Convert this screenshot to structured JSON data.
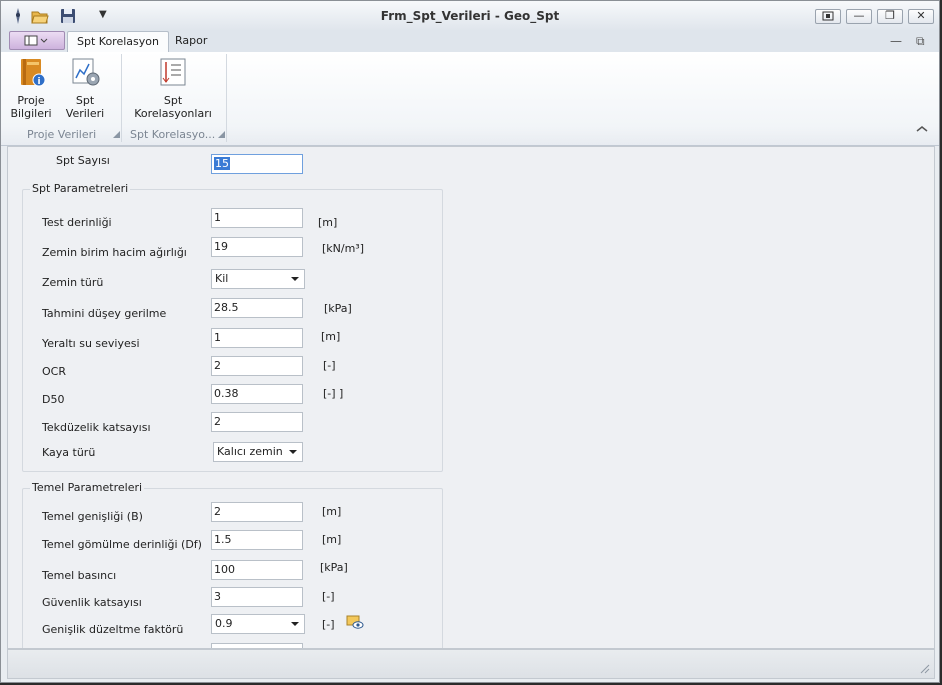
{
  "window": {
    "title_form": "Frm_Spt_Verileri",
    "title_separator": " - ",
    "title_app": "Geo_Spt",
    "minimize_label": "—",
    "restore_label": "❐",
    "close_label": "✕"
  },
  "tabs": [
    {
      "label": "Spt Korelasyon",
      "active": true
    },
    {
      "label": "Rapor",
      "active": false
    }
  ],
  "ribbon": {
    "buttons": [
      {
        "line1": "Proje",
        "line2": "Bilgileri"
      },
      {
        "line1": "Spt Verileri"
      },
      {
        "line1": "Spt Korelasyonları"
      }
    ],
    "groups": [
      "Proje Verileri",
      "Spt Korelasyo..."
    ]
  },
  "form": {
    "spt_sayisi_label": "Spt Sayısı",
    "spt_sayisi_value": "15",
    "spt_group_title": "Spt Parametreleri",
    "spt_fields": [
      {
        "label": "Test derinliği",
        "value": "1",
        "unit": "[m]"
      },
      {
        "label": "Zemin birim hacim ağırlığı",
        "value": "19",
        "unit": "[kN/m³]"
      },
      {
        "label": "Zemin türü",
        "value": "Kil",
        "unit": ""
      },
      {
        "label": "Tahmini düşey gerilme",
        "value": "28.5",
        "unit": "[kPa]"
      },
      {
        "label": "Yeraltı su seviyesi",
        "value": "1",
        "unit": "[m]"
      },
      {
        "label": "OCR",
        "value": "2",
        "unit": "[-]"
      },
      {
        "label": "D50",
        "value": "0.38",
        "unit": "[-] ]"
      },
      {
        "label": "Tekdüzelik katsayısı",
        "value": "2",
        "unit": ""
      },
      {
        "label": "Kaya türü",
        "value": "Kalıcı zemin",
        "unit": ""
      }
    ],
    "temel_group_title": "Temel Parametreleri",
    "temel_fields": [
      {
        "label": "Temel genişliği (B)",
        "value": "2",
        "unit": "[m]"
      },
      {
        "label": "Temel gömülme derinliği (Df)",
        "value": "1.5",
        "unit": "[m]"
      },
      {
        "label": "Temel  basıncı",
        "value": "100",
        "unit": "[kPa]"
      },
      {
        "label": "Güvenlik katsayısı",
        "value": "3",
        "unit": "[-]"
      },
      {
        "label": "Genişlik düzeltme faktörü",
        "value": "0.9",
        "unit": "[-]"
      }
    ]
  },
  "icons": {
    "app": "app-icon",
    "open": "folder-open-icon",
    "save": "save-icon",
    "qat_dropdown": "dropdown-arrow-icon",
    "proje_bilgileri": "project-book-info-icon",
    "spt_verileri": "chart-gear-icon",
    "spt_korelasyonlari": "chart-list-icon",
    "view_info": "view-info-icon"
  },
  "colors": {
    "accent_selection": "#3a7bd5",
    "app_menu": "#cdb2dd"
  }
}
